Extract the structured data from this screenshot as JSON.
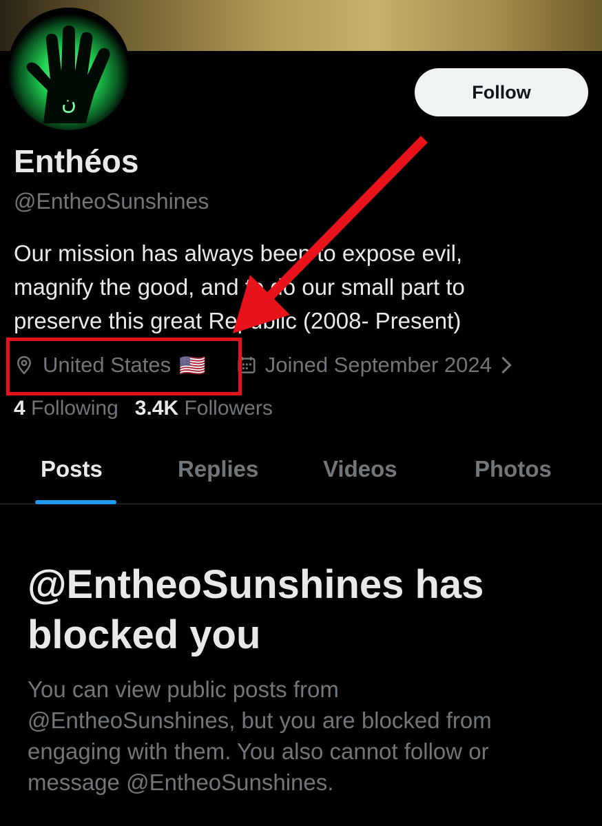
{
  "profile": {
    "display_name": "Enthéos",
    "handle": "@EntheoSunshines",
    "follow_label": "Follow",
    "avatar_icon": "green-glowing-hand-icon",
    "bio_lines": [
      "Our mission has always been to expose evil,",
      "magnify the good, and to do our small part to",
      "preserve this great Republic (2008- Present)"
    ],
    "location": "United States",
    "location_flag": "🇺🇸",
    "joined": "Joined September 2024",
    "following_count": "4",
    "following_label": "Following",
    "followers_count": "3.4K",
    "followers_label": "Followers"
  },
  "tabs": [
    {
      "label": "Posts",
      "active": true
    },
    {
      "label": "Replies",
      "active": false
    },
    {
      "label": "Videos",
      "active": false
    },
    {
      "label": "Photos",
      "active": false
    }
  ],
  "blocked": {
    "title_lines": [
      "@EntheoSunshines has",
      "blocked you"
    ],
    "body_lines": [
      "You can view public posts from",
      "@EntheoSunshines, but you are blocked from",
      "engaging with them. You also cannot follow or",
      "message @EntheoSunshines."
    ]
  },
  "annotation": {
    "highlight_color": "#e8121a",
    "arrow_color": "#e8121a"
  },
  "colors": {
    "background": "#000000",
    "text_primary": "#e7e9ea",
    "text_secondary": "#71767b",
    "accent": "#1d9bf0",
    "follow_button_bg": "#eff3f4"
  }
}
